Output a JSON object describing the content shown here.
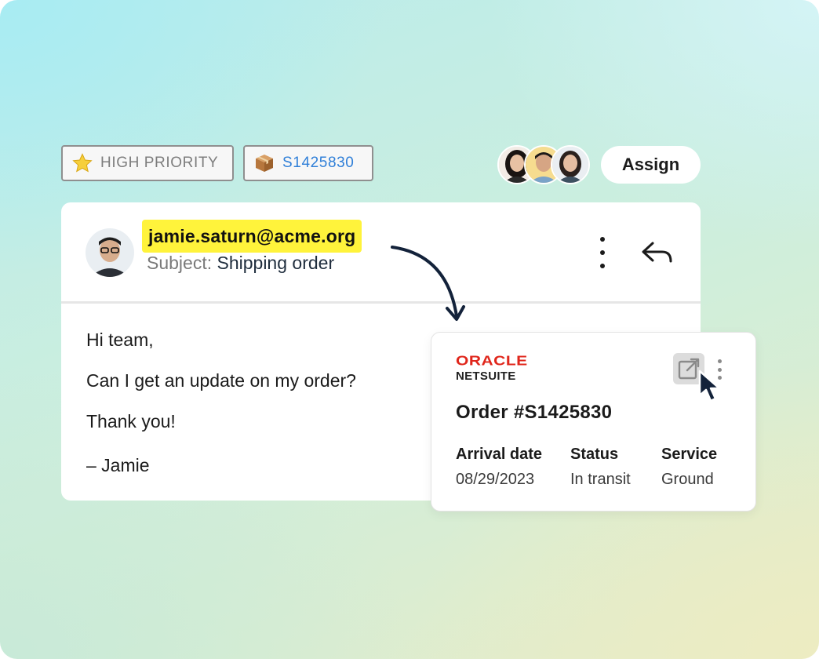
{
  "tags": {
    "priority": {
      "icon": "star-icon",
      "label": "HIGH PRIORITY"
    },
    "order": {
      "icon": "package-icon",
      "label": "S1425830"
    }
  },
  "assign_button": {
    "label": "Assign"
  },
  "email": {
    "sender": "jamie.saturn@acme.org",
    "subject_label": "Subject:",
    "subject": "Shipping order",
    "body": [
      "Hi team,",
      "Can I get an update on my order?",
      "Thank you!",
      "– Jamie"
    ]
  },
  "netsuite_card": {
    "brand_line1": "ORACLE",
    "brand_line2": "NETSUITE",
    "order_title": "Order #S1425830",
    "columns": [
      {
        "label": "Arrival date",
        "value": "08/29/2023"
      },
      {
        "label": "Status",
        "value": "In transit"
      },
      {
        "label": "Service",
        "value": "Ground"
      }
    ]
  },
  "colors": {
    "highlight": "#fff33b",
    "oracle_red": "#e0261b",
    "order_tag_blue": "#2f7fd8",
    "arrow": "#13223a"
  }
}
